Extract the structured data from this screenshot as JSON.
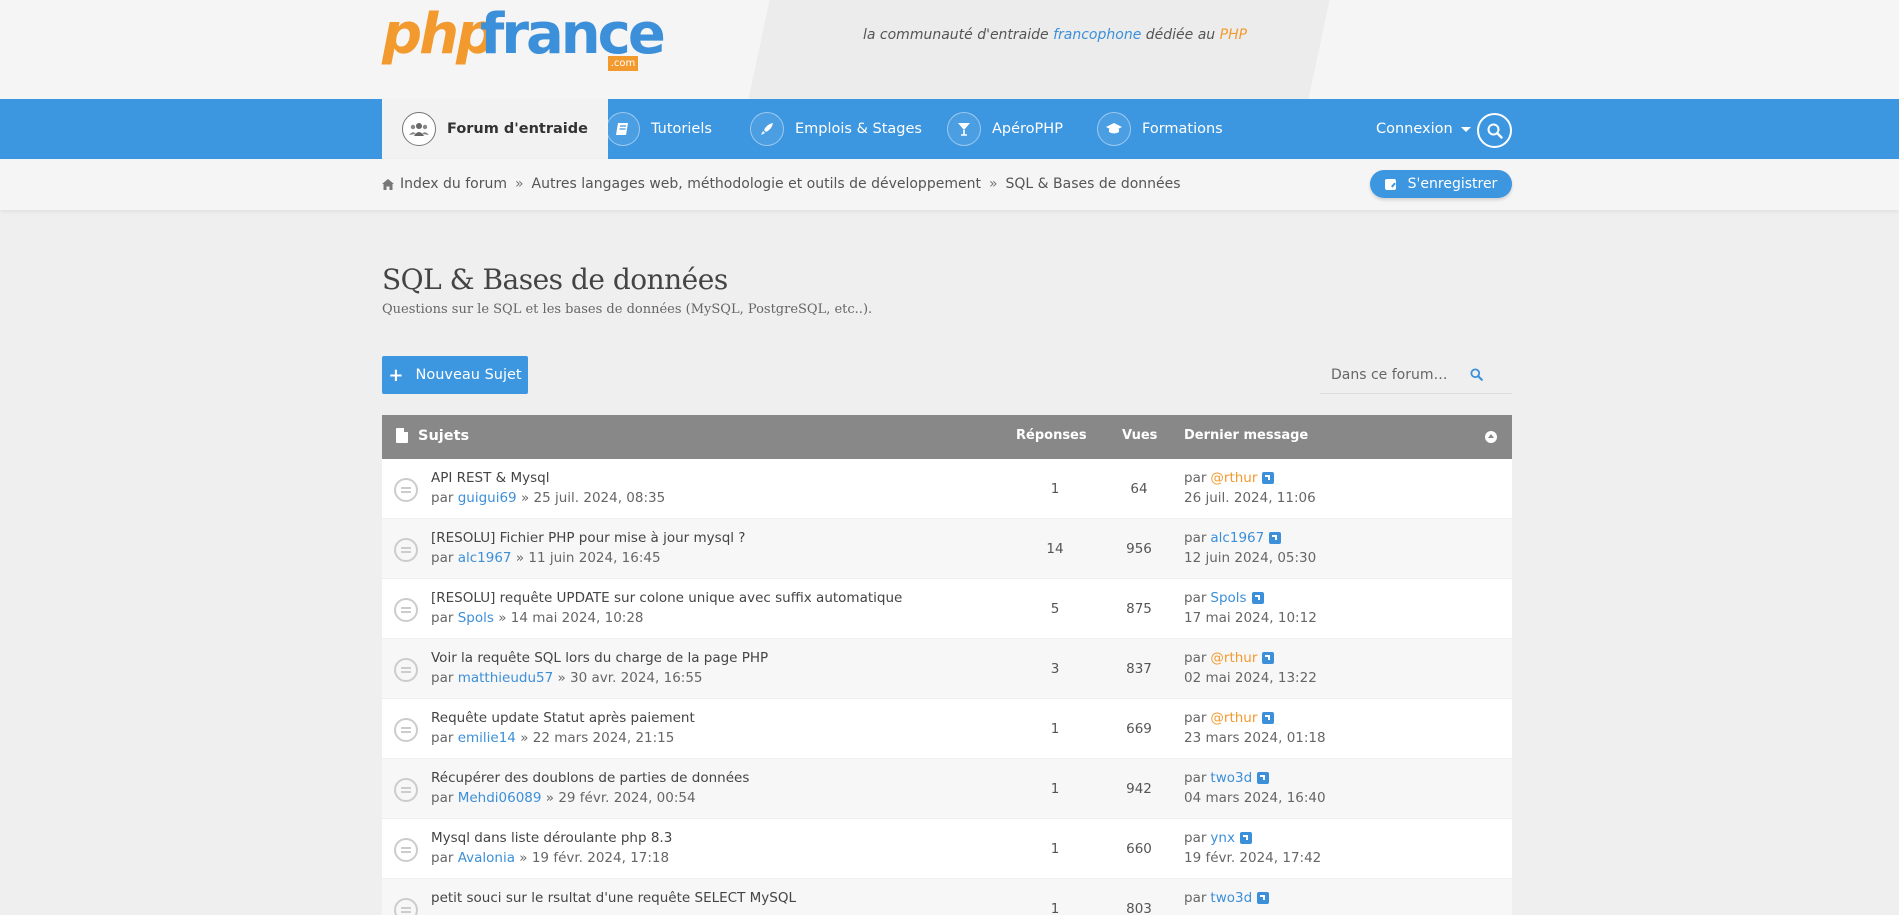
{
  "header": {
    "logo_php": "php",
    "logo_france": "france",
    "logo_com": ".com",
    "tagline_before": "la communauté d'entraide ",
    "tagline_blue": "francophone",
    "tagline_middle": " dédiée au ",
    "tagline_orange": "PHP"
  },
  "nav": {
    "items": [
      {
        "label": "Forum d'entraide",
        "icon": "users-icon"
      },
      {
        "label": "Tutoriels",
        "icon": "book-icon"
      },
      {
        "label": "Emplois & Stages",
        "icon": "rocket-icon"
      },
      {
        "label": "ApéroPHP",
        "icon": "cocktail-icon"
      },
      {
        "label": "Formations",
        "icon": "graduation-cap-icon"
      }
    ],
    "connexion": "Connexion"
  },
  "breadcrumb": {
    "items": [
      "Index du forum",
      "Autres langages web, méthodologie et outils de développement",
      "SQL & Bases de données"
    ],
    "separator": "»"
  },
  "register_label": "S'enregistrer",
  "forum": {
    "title": "SQL & Bases de données",
    "description": "Questions sur le SQL et les bases de données (MySQL, PostgreSQL, etc..).",
    "new_topic": "Nouveau Sujet",
    "search_placeholder": "Dans ce forum…"
  },
  "list": {
    "headers": {
      "topics": "Sujets",
      "replies": "Réponses",
      "views": "Vues",
      "last": "Dernier message"
    },
    "by": "par",
    "rows": [
      {
        "title": "API REST & Mysql",
        "author": "guigui69",
        "date": "» 25 juil. 2024, 08:35",
        "replies": "1",
        "views": "64",
        "last_user": "@rthur",
        "last_user_color": "orange",
        "last_date": "26 juil. 2024, 11:06"
      },
      {
        "title": "[RESOLU] Fichier PHP pour mise à jour mysql ?",
        "author": "alc1967",
        "date": "» 11 juin 2024, 16:45",
        "replies": "14",
        "views": "956",
        "last_user": "alc1967",
        "last_user_color": "blue",
        "last_date": "12 juin 2024, 05:30"
      },
      {
        "title": "[RESOLU] requête UPDATE sur colone unique avec suffix automatique",
        "author": "Spols",
        "date": "» 14 mai 2024, 10:28",
        "replies": "5",
        "views": "875",
        "last_user": "Spols",
        "last_user_color": "blue",
        "last_date": "17 mai 2024, 10:12"
      },
      {
        "title": "Voir la requête SQL lors du charge de la page PHP",
        "author": "matthieudu57",
        "date": "» 30 avr. 2024, 16:55",
        "replies": "3",
        "views": "837",
        "last_user": "@rthur",
        "last_user_color": "orange",
        "last_date": "02 mai 2024, 13:22"
      },
      {
        "title": "Requête update Statut après paiement",
        "author": "emilie14",
        "date": "» 22 mars 2024, 21:15",
        "replies": "1",
        "views": "669",
        "last_user": "@rthur",
        "last_user_color": "orange",
        "last_date": "23 mars 2024, 01:18"
      },
      {
        "title": "Récupérer des doublons de parties de données",
        "author": "Mehdi06089",
        "date": "» 29 févr. 2024, 00:54",
        "replies": "1",
        "views": "942",
        "last_user": "two3d",
        "last_user_color": "blue",
        "last_date": "04 mars 2024, 16:40"
      },
      {
        "title": "Mysql dans liste déroulante php 8.3",
        "author": "Avalonia",
        "date": "» 19 févr. 2024, 17:18",
        "replies": "1",
        "views": "660",
        "last_user": "ynx",
        "last_user_color": "blue",
        "last_date": "19 févr. 2024, 17:42"
      },
      {
        "title": "petit souci sur le rsultat d'une requête SELECT MySQL",
        "author": "",
        "date": "",
        "replies": "1",
        "views": "803",
        "last_user": "two3d",
        "last_user_color": "blue",
        "last_date": ""
      }
    ]
  },
  "colors": {
    "accent": "#3c96e0",
    "orange": "#f39a2f",
    "header_gray": "#888888"
  }
}
